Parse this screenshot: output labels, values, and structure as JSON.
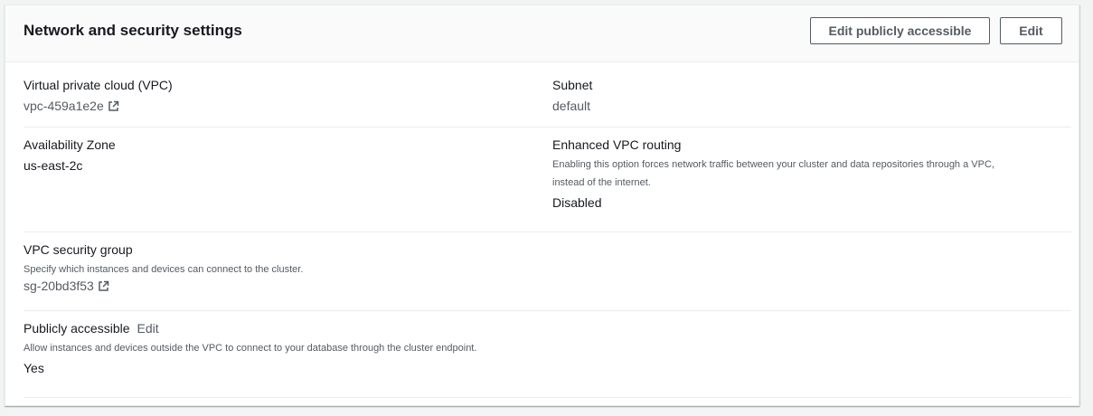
{
  "panel": {
    "title": "Network and security settings",
    "buttons": {
      "edit_publicly_accessible": "Edit publicly accessible",
      "edit": "Edit"
    }
  },
  "fields": {
    "vpc": {
      "label": "Virtual private cloud (VPC)",
      "value": "vpc-459a1e2e",
      "icon": "external-link-icon"
    },
    "subnet": {
      "label": "Subnet",
      "value": "default"
    },
    "availability_zone": {
      "label": "Availability Zone",
      "value": "us-east-2c"
    },
    "enhanced_vpc_routing": {
      "label": "Enhanced VPC routing",
      "description_line1": "Enabling this option forces network traffic between your cluster and data repositories through a VPC,",
      "description_line2": "instead of the internet.",
      "value": "Disabled"
    },
    "vpc_security_group": {
      "label": "VPC security group",
      "description": "Specify which instances and devices can connect to the cluster.",
      "value": "sg-20bd3f53",
      "icon": "external-link-icon"
    },
    "publicly_accessible": {
      "label": "Publicly accessible",
      "edit_label": "Edit",
      "description": "Allow instances and devices outside the VPC to connect to your database through the cluster endpoint.",
      "value": "Yes"
    }
  }
}
